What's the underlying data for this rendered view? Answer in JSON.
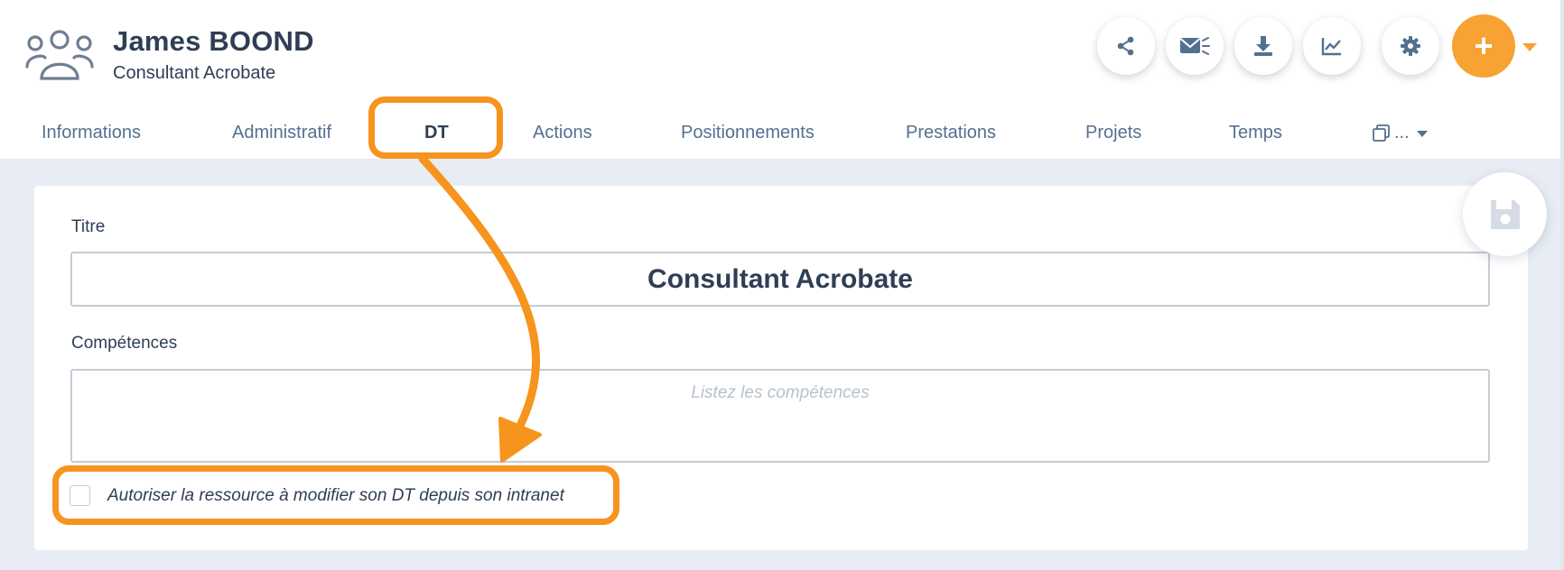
{
  "header": {
    "name": "James BOOND",
    "subtitle": "Consultant Acrobate",
    "avatar_icon": "group-users-icon"
  },
  "actions": [
    {
      "icon": "share-icon"
    },
    {
      "icon": "mail-broadcast-icon"
    },
    {
      "icon": "download-icon"
    },
    {
      "icon": "chart-icon"
    },
    {
      "icon": "gear-icon"
    }
  ],
  "add_button": {
    "label": "+",
    "color": "#f7a232"
  },
  "tabs": [
    {
      "label": "Informations"
    },
    {
      "label": "Administratif"
    },
    {
      "label": "DT"
    },
    {
      "label": "Actions"
    },
    {
      "label": "Positionnements"
    },
    {
      "label": "Prestations"
    },
    {
      "label": "Projets"
    },
    {
      "label": "Temps"
    },
    {
      "label": "..."
    }
  ],
  "active_tab": "DT",
  "form": {
    "title_label": "Titre",
    "title_value": "Consultant Acrobate",
    "skills_label": "Compétences",
    "skills_placeholder": "Listez les compétences",
    "skills_value": "",
    "checkbox_label": "Autoriser la ressource à modifier son DT depuis son intranet",
    "checkbox_checked": false
  },
  "save_icon": "floppy-disk-icon",
  "colors": {
    "accent": "#f7a232",
    "highlight": "#f7941d",
    "text": "#2f3e55",
    "tab_text": "#54708f",
    "background": "#e8edf5"
  }
}
